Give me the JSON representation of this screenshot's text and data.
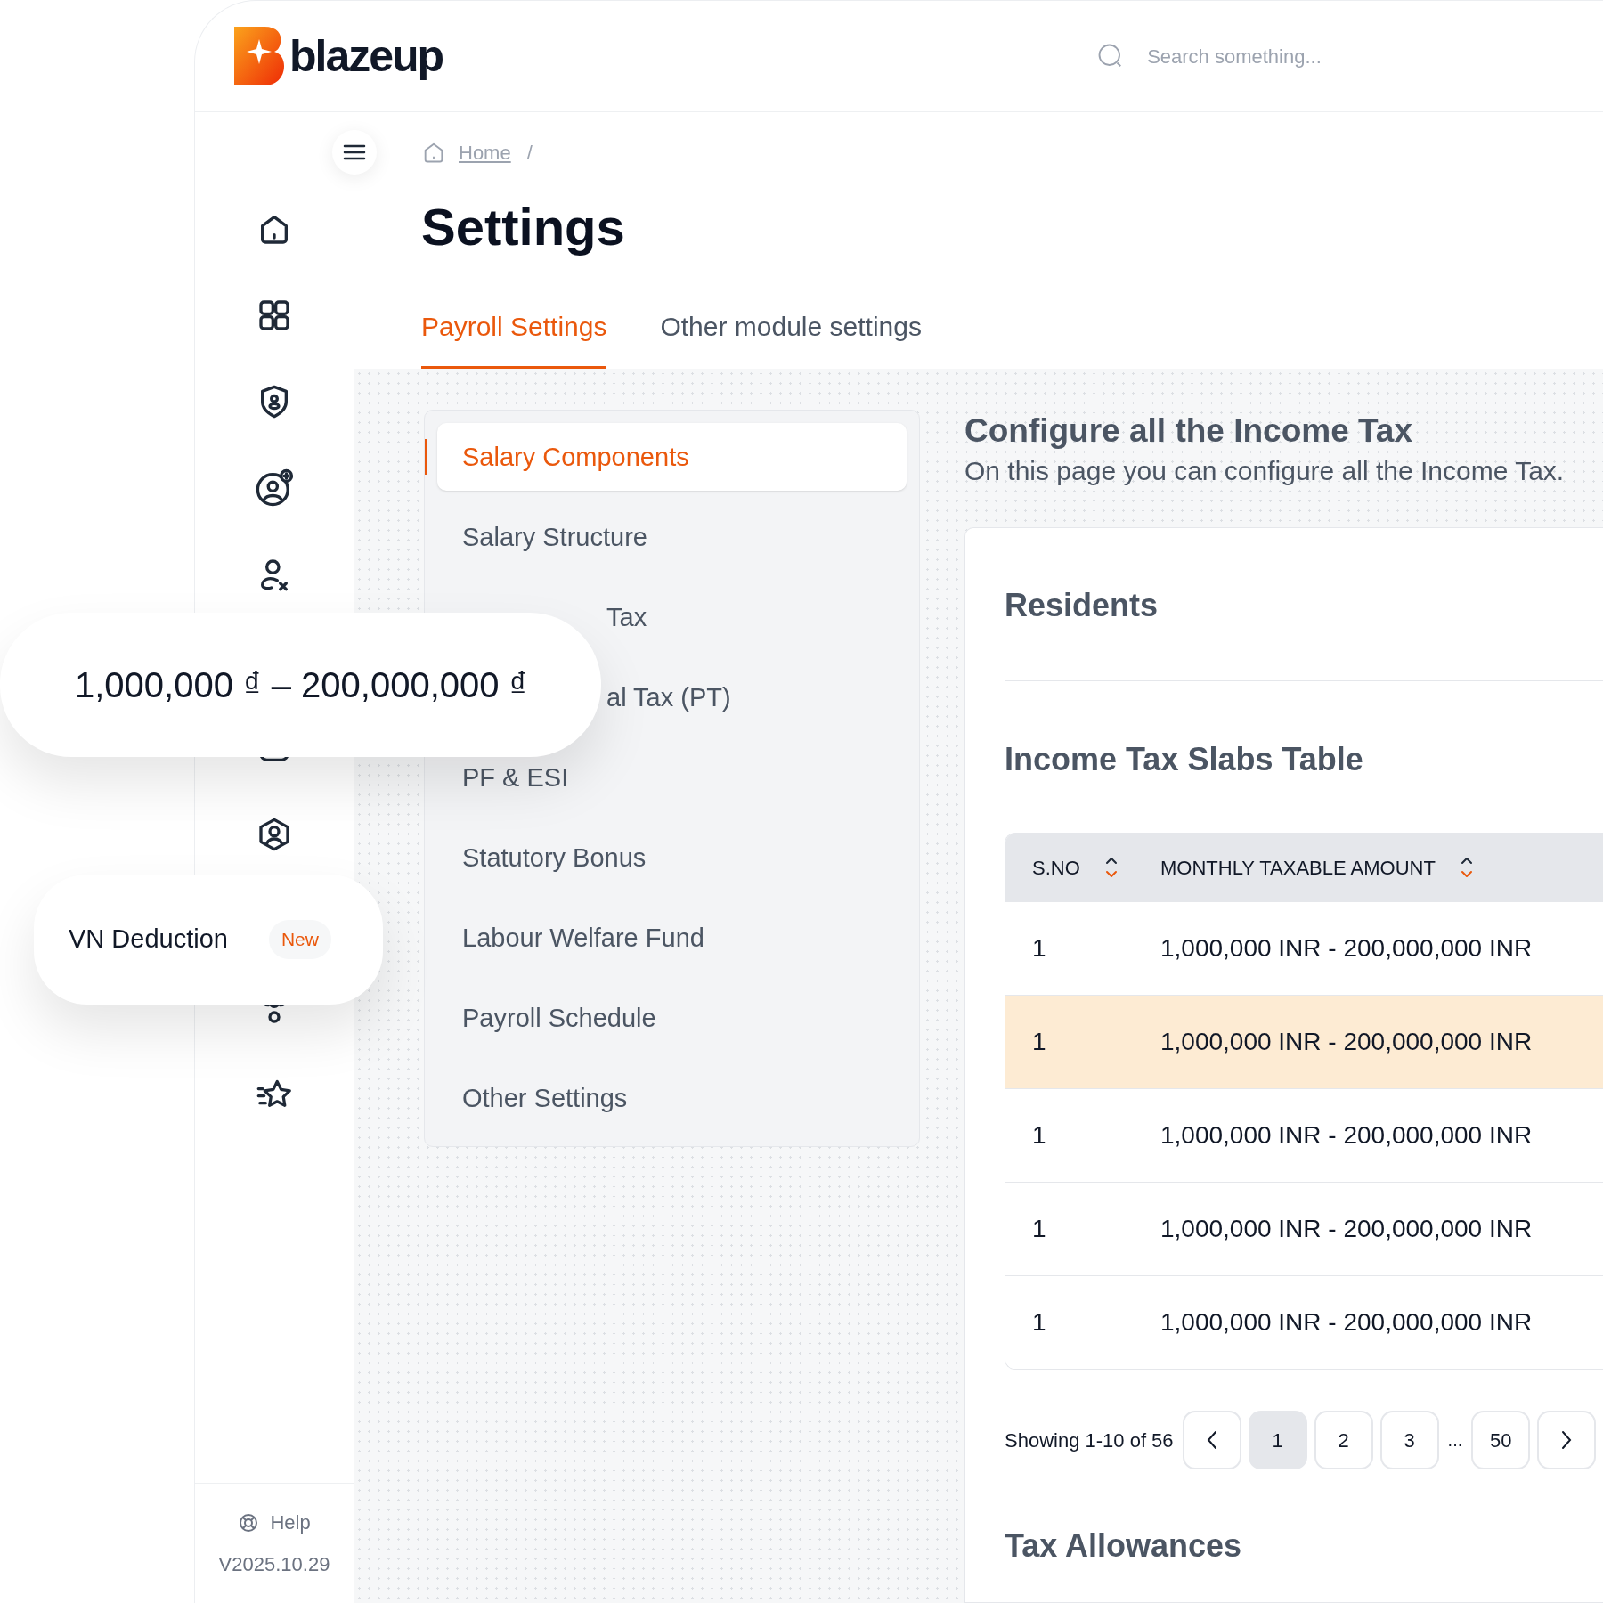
{
  "brand": {
    "name": "blazeup"
  },
  "search": {
    "placeholder": "Search something..."
  },
  "breadcrumb": [
    {
      "label": "Home"
    }
  ],
  "breadcrumb_separator": "/",
  "title": "Settings",
  "tabs": [
    {
      "label": "Payroll Settings",
      "selected": true
    },
    {
      "label": "Other module settings",
      "selected": false
    }
  ],
  "settings_menu": [
    {
      "label": "Salary Components",
      "selected": true,
      "kind": "full"
    },
    {
      "label": "Salary Structure",
      "selected": false,
      "kind": "full"
    },
    {
      "label": "Tax",
      "selected": false,
      "kind": "clipped"
    },
    {
      "label": "al Tax (PT)",
      "selected": false,
      "kind": "clipped"
    },
    {
      "label": "PF & ESI",
      "selected": false,
      "kind": "full"
    },
    {
      "label": "Statutory Bonus",
      "selected": false,
      "kind": "full"
    },
    {
      "label": "Labour Welfare Fund",
      "selected": false,
      "kind": "full"
    },
    {
      "label": "Payroll Schedule",
      "selected": false,
      "kind": "full"
    },
    {
      "label": "Other Settings",
      "selected": false,
      "kind": "full"
    }
  ],
  "content": {
    "heading": "Configure all the Income Tax",
    "subheading": "On this page you can configure all the Income Tax.",
    "section": "Residents",
    "table_title": "Income Tax Slabs Table",
    "table": {
      "columns": [
        "S.NO",
        "MONTHLY TAXABLE AMOUNT"
      ],
      "rows": [
        {
          "cells": [
            "1",
            "1,000,000 INR - 200,000,000 INR"
          ],
          "selected": false
        },
        {
          "cells": [
            "1",
            "1,000,000 INR - 200,000,000 INR"
          ],
          "selected": true
        },
        {
          "cells": [
            "1",
            "1,000,000 INR - 200,000,000 INR"
          ],
          "selected": false
        },
        {
          "cells": [
            "1",
            "1,000,000 INR - 200,000,000 INR"
          ],
          "selected": false
        },
        {
          "cells": [
            "1",
            "1,000,000 INR - 200,000,000 INR"
          ],
          "selected": false
        }
      ]
    },
    "pagination": {
      "summary": "Showing 1-10 of 56",
      "pages": [
        {
          "label": "1",
          "selected": true
        },
        {
          "label": "2",
          "selected": false
        },
        {
          "label": "3",
          "selected": false
        },
        {
          "label": "...",
          "kind": "gap"
        },
        {
          "label": "50",
          "selected": false
        }
      ]
    },
    "next_section": "Tax Allowances"
  },
  "help": {
    "label": "Help"
  },
  "version": "V2025.10.29",
  "amount_card": {
    "text": "1,000,000 ₫ – 200,000,000 ₫"
  },
  "deduction_card": {
    "label": "VN Deduction",
    "badge": "New"
  }
}
